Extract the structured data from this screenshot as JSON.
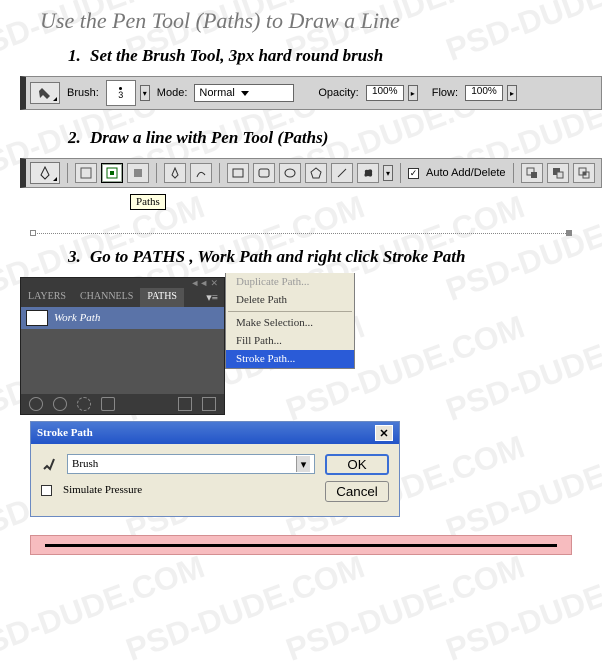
{
  "watermark": "PSD-DUDE.COM",
  "title": "Use the Pen Tool (Paths) to Draw a Line",
  "step1": {
    "num": "1.",
    "text": "Set the Brush Tool, 3px hard round brush"
  },
  "step2": {
    "num": "2.",
    "text": "Draw a line with Pen Tool (Paths)"
  },
  "step3": {
    "num": "3.",
    "text": "Go to PATHS , Work Path and right click Stroke Path"
  },
  "brushbar": {
    "brush_label": "Brush:",
    "brush_size": "3",
    "mode_label": "Mode:",
    "mode_value": "Normal",
    "opacity_label": "Opacity:",
    "opacity_value": "100%",
    "flow_label": "Flow:",
    "flow_value": "100%"
  },
  "penbar": {
    "auto_add": "Auto Add/Delete",
    "tooltip": "Paths"
  },
  "panel": {
    "tabs": {
      "layers": "LAYERS",
      "channels": "CHANNELS",
      "paths": "PATHS"
    },
    "work_path": "Work Path"
  },
  "ctx": {
    "duplicate": "Duplicate Path...",
    "delete": "Delete Path",
    "make_sel": "Make Selection...",
    "fill": "Fill Path...",
    "stroke": "Stroke Path..."
  },
  "dialog": {
    "title": "Stroke Path",
    "tool": "Brush",
    "simulate": "Simulate Pressure",
    "ok": "OK",
    "cancel": "Cancel"
  }
}
